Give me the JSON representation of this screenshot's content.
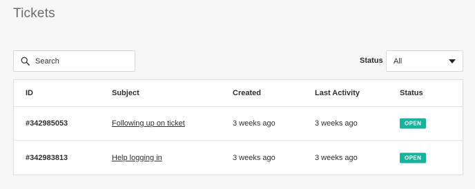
{
  "page": {
    "title": "Tickets"
  },
  "search": {
    "placeholder": "Search"
  },
  "filter": {
    "label": "Status",
    "selected": "All"
  },
  "table": {
    "headers": {
      "id": "ID",
      "subject": "Subject",
      "created": "Created",
      "last_activity": "Last Activity",
      "status": "Status"
    },
    "rows": [
      {
        "id": "#342985053",
        "subject": "Following up on ticket",
        "created": "3 weeks ago",
        "last_activity": "3 weeks ago",
        "status": "OPEN"
      },
      {
        "id": "#342983813",
        "subject": "Help logging in",
        "created": "3 weeks ago",
        "last_activity": "3 weeks ago",
        "status": "OPEN"
      }
    ]
  },
  "colors": {
    "status_open": "#17b29b",
    "background": "#f6f6f7"
  },
  "icons": {
    "search": "search-icon",
    "dropdown": "chevron-down-icon"
  }
}
